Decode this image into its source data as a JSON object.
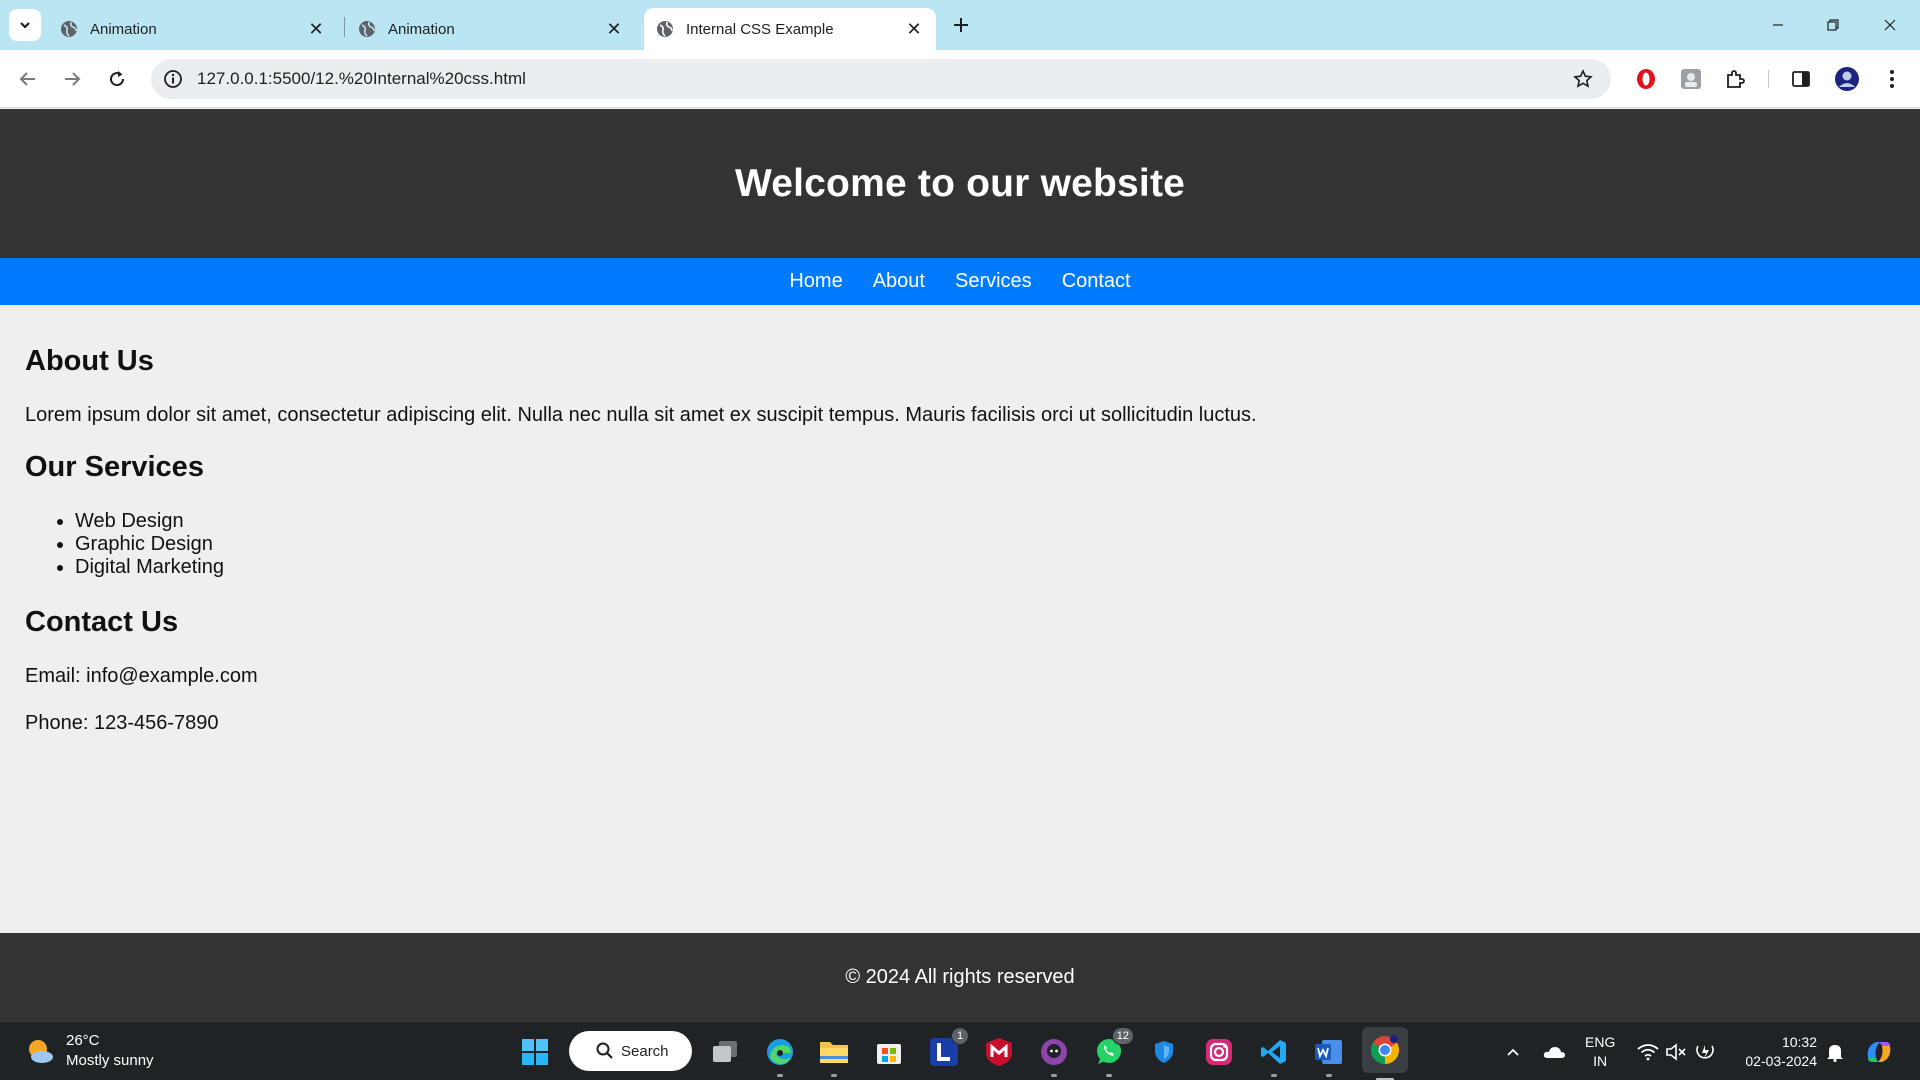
{
  "browser": {
    "tabs": [
      {
        "title": "Animation",
        "active": false
      },
      {
        "title": "Animation",
        "active": false
      },
      {
        "title": "Internal CSS Example",
        "active": true
      }
    ],
    "url": "127.0.0.1:5500/12.%20Internal%20css.html"
  },
  "site": {
    "header_title": "Welcome to our website",
    "nav": [
      "Home",
      "About",
      "Services",
      "Contact"
    ],
    "about_heading": "About Us",
    "about_text": "Lorem ipsum dolor sit amet, consectetur adipiscing elit. Nulla nec nulla sit amet ex suscipit tempus. Mauris facilisis orci ut sollicitudin luctus.",
    "services_heading": "Our Services",
    "services": [
      "Web Design",
      "Graphic Design",
      "Digital Marketing"
    ],
    "contact_heading": "Contact Us",
    "email": "Email: info@example.com",
    "phone": "Phone: 123-456-7890",
    "footer": "© 2024 All rights reserved"
  },
  "taskbar": {
    "weather_temp": "26°C",
    "weather_desc": "Mostly sunny",
    "search_label": "Search",
    "l_badge": "1",
    "whatsapp_badge": "12",
    "lang_line1": "ENG",
    "lang_line2": "IN",
    "time": "10:32",
    "date": "02-03-2024"
  },
  "colors": {
    "header_bg": "#333333",
    "nav_bg": "#007bff",
    "page_bg": "#efefef",
    "tabstrip_bg": "#b9e6f2"
  }
}
